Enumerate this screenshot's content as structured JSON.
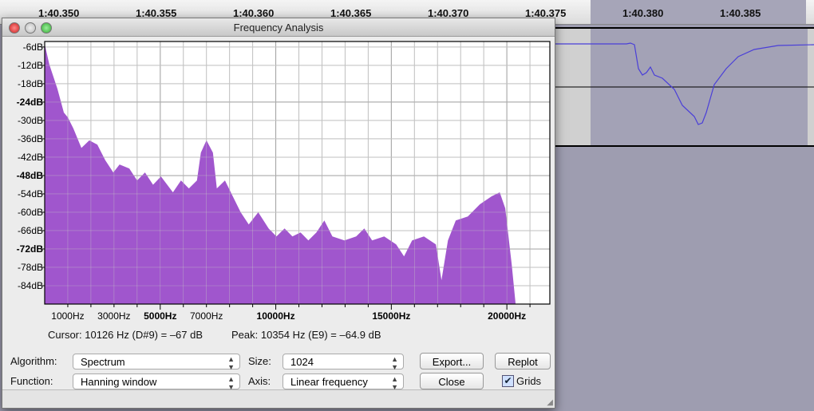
{
  "timeline": {
    "ticks": [
      "1:40.350",
      "1:40.355",
      "1:40.360",
      "1:40.365",
      "1:40.370",
      "1:40.375",
      "1:40.380",
      "1:40.385"
    ]
  },
  "dialog": {
    "title": "Frequency Analysis",
    "cursor_text": "Cursor: 10126 Hz (D#9) = –67 dB",
    "peak_text": "Peak: 10354 Hz (E9) = –64.9 dB",
    "algorithm_label": "Algorithm:",
    "algorithm_value": "Spectrum",
    "function_label": "Function:",
    "function_value": "Hanning window",
    "size_label": "Size:",
    "size_value": "1024",
    "axis_label": "Axis:",
    "axis_value": "Linear frequency",
    "export_label": "Export...",
    "replot_label": "Replot",
    "close_label": "Close",
    "grids_label": "Grids",
    "grids_checked": true
  },
  "chart_data": {
    "type": "area",
    "color": "#9b4dca",
    "xlim": [
      0,
      21860
    ],
    "ylim": [
      -90,
      -4.2
    ],
    "grid": true,
    "xticks": [
      "1000Hz",
      "3000Hz",
      "5000Hz",
      "7000Hz",
      "10000Hz",
      "15000Hz",
      "20000Hz"
    ],
    "xtick_values": [
      1000,
      3000,
      5000,
      7000,
      10000,
      15000,
      20000
    ],
    "yticks": [
      "-6dB",
      "-12dB",
      "-18dB",
      "-24dB",
      "-30dB",
      "-36dB",
      "-42dB",
      "-48dB",
      "-54dB",
      "-60dB",
      "-66dB",
      "-72dB",
      "-78dB",
      "-84dB"
    ],
    "ytick_values": [
      -6,
      -12,
      -18,
      -24,
      -30,
      -36,
      -42,
      -48,
      -54,
      -60,
      -66,
      -72,
      -78,
      -84
    ],
    "x": [
      0,
      200,
      550,
      830,
      1000,
      1240,
      1590,
      1930,
      2280,
      2620,
      2970,
      3240,
      3660,
      4000,
      4340,
      4690,
      5030,
      5550,
      5900,
      6240,
      6590,
      6760,
      7000,
      7280,
      7450,
      7800,
      8140,
      8480,
      8830,
      9240,
      9690,
      10030,
      10380,
      10720,
      11070,
      11410,
      11760,
      12100,
      12450,
      12970,
      13480,
      13830,
      14170,
      14690,
      15210,
      15550,
      15900,
      16410,
      16930,
      17170,
      17450,
      17790,
      18310,
      18830,
      19340,
      19690,
      19930,
      20210,
      20380
    ],
    "y": [
      -5,
      -11.7,
      -19.6,
      -27.4,
      -29,
      -32.6,
      -39,
      -36.5,
      -37.9,
      -43,
      -47,
      -44.4,
      -45.7,
      -49.6,
      -47,
      -51,
      -48.3,
      -53.5,
      -49.6,
      -52.2,
      -49.6,
      -40.5,
      -36.5,
      -40.5,
      -52.2,
      -49.6,
      -54.8,
      -60,
      -64,
      -60,
      -65.3,
      -67.9,
      -65.3,
      -67.9,
      -66.6,
      -69.2,
      -66.6,
      -62.7,
      -67.9,
      -69.2,
      -67.9,
      -65.3,
      -69.2,
      -67.9,
      -70.5,
      -74.4,
      -69.2,
      -67.9,
      -70.5,
      -82.2,
      -69.2,
      -62.7,
      -61.4,
      -57.4,
      -54.8,
      -53.5,
      -58.7,
      -77,
      -90
    ]
  }
}
